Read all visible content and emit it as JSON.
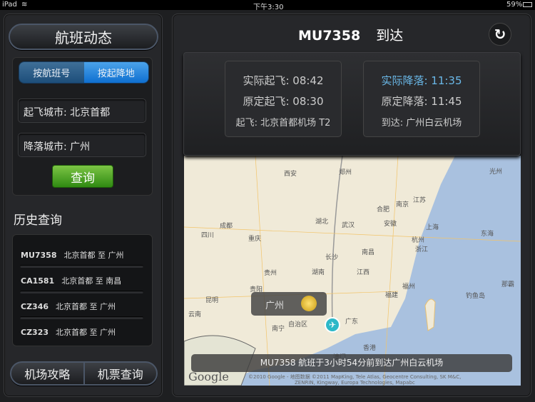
{
  "status": {
    "device": "iPad",
    "time": "下午3:30",
    "battery": "59%"
  },
  "sidebar": {
    "title": "航班动态",
    "tabs": [
      {
        "label": "按航班号"
      },
      {
        "label": "按起降地"
      }
    ],
    "from_label": "起飞城市:",
    "from_value": "北京首都",
    "to_label": "降落城市:",
    "to_value": "广州",
    "search_label": "查询",
    "history_title": "历史查询",
    "history": [
      {
        "flight": "MU7358",
        "route": "北京首都 至 广州"
      },
      {
        "flight": "CA1581",
        "route": "北京首都 至 南昌"
      },
      {
        "flight": "CZ346",
        "route": "北京首都 至 广州"
      },
      {
        "flight": "CZ323",
        "route": "北京首都 至 广州"
      }
    ],
    "bottom": [
      {
        "label": "机场攻略"
      },
      {
        "label": "机票查询"
      }
    ]
  },
  "main": {
    "flight": "MU7358",
    "state": "到达",
    "departure": {
      "actual": "实际起飞: 08:42",
      "scheduled": "原定起飞: 08:30",
      "airport": "起飞: 北京首都机场 T2"
    },
    "arrival": {
      "actual": "实际降落: 11:35",
      "scheduled": "原定降落: 11:45",
      "airport": "到达: 广州白云机场"
    },
    "weather_city": "广州",
    "banner": "MU7358 航班于3小时54分前到达广州白云机场",
    "google": "Google",
    "copyright1": "©2010 Google - 地图数据 ©2011 MapKing, Tele Atlas, Geocentre Consulting, SK M&C,",
    "copyright2": "ZENRIN, Kingway, Europa Technologies, Mapabc",
    "accent": "#6ab8e8"
  },
  "map": {
    "labels": [
      "西安",
      "郑州",
      "光州",
      "江苏",
      "合肥",
      "南京",
      "上海",
      "成都",
      "湖北",
      "武汉",
      "安徽",
      "东海",
      "四川",
      "重庆",
      "杭州",
      "浙江",
      "长沙",
      "南昌",
      "贵州",
      "湖南",
      "江西",
      "那霸",
      "贵阳",
      "福建",
      "福州",
      "钓鱼岛",
      "昆明",
      "云南",
      "广东",
      "南宁",
      "自治区",
      "香港",
      "澳门"
    ]
  }
}
